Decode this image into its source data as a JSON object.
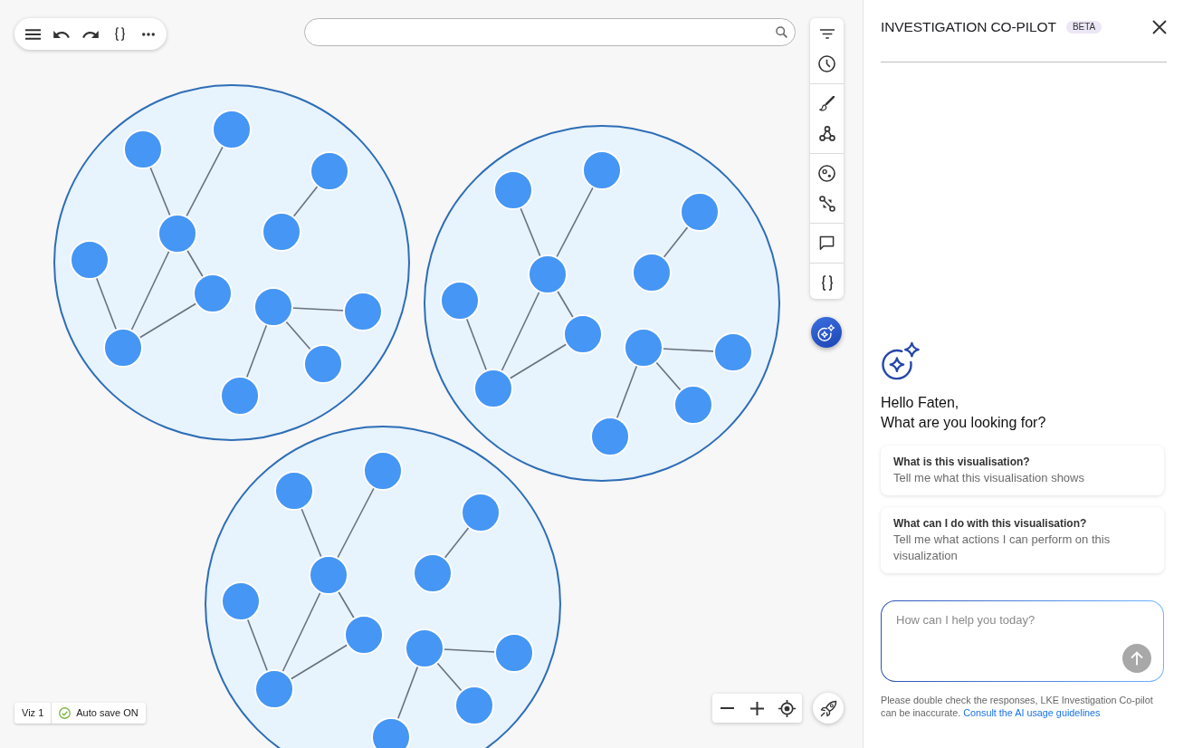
{
  "status_bar": {
    "visualization": "Viz 1",
    "auto_save": {
      "label": "Auto save ON",
      "on": true
    }
  },
  "panel": {
    "title": "INVESTIGATION CO-PILOT",
    "badge": "BETA",
    "greeting": [
      "Hello Faten,",
      "What are you looking for?"
    ],
    "suggestions": [
      {
        "title": "What is this visualisation?",
        "description": "Tell me what this visualisation shows"
      },
      {
        "title": "What can I do with this visualisation?",
        "description": "Tell me what actions I can perform on this visualization"
      }
    ],
    "chat_input": {
      "placeholder": "How can I help you today?"
    },
    "send_button": {
      "disabled": true
    },
    "disclaimer": {
      "text": "Please double check the responses, LKE Investigation Co-pilot can be inaccurate.",
      "link": "Consult the AI usage guidelines"
    }
  }
}
